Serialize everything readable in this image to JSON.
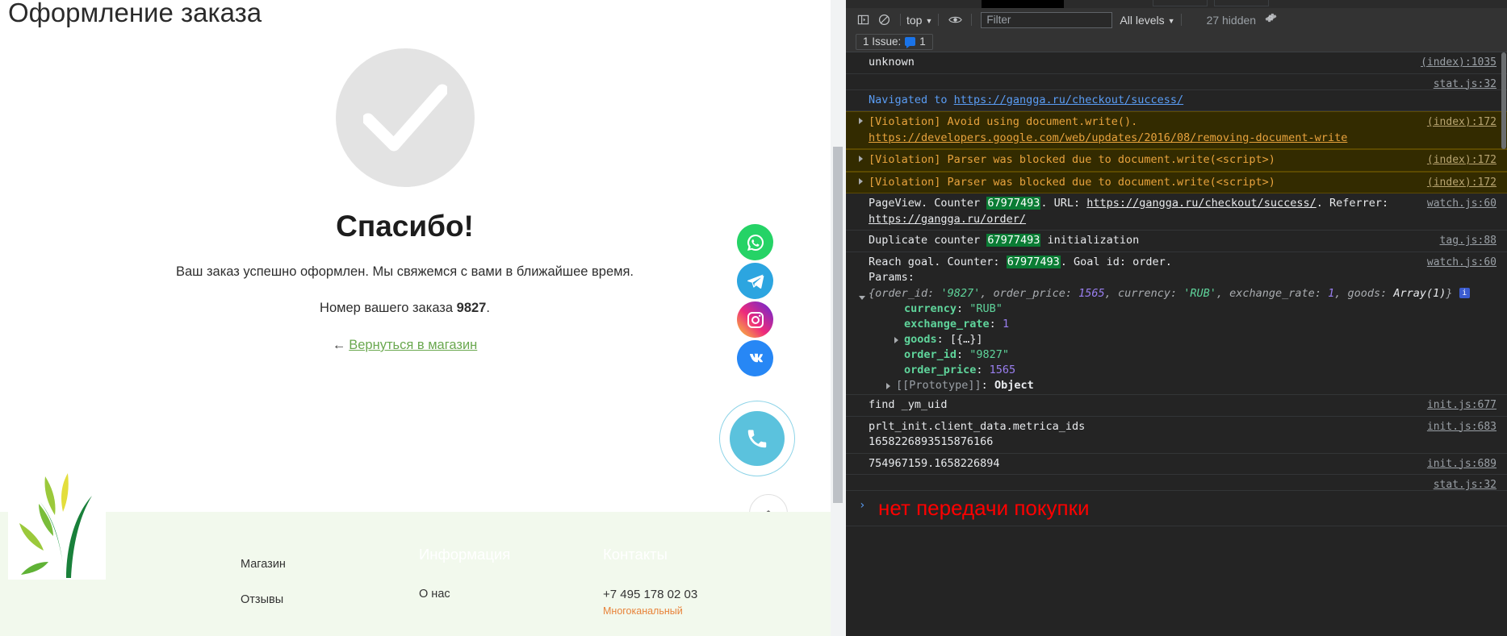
{
  "page": {
    "title": "Оформление заказа",
    "success": {
      "check_icon": "check-mark-icon",
      "heading": "Спасибо!",
      "subtext": "Ваш заказ успешно оформлен. Мы свяжемся с вами в ближайшее время.",
      "order_prefix": "Номер вашего заказа ",
      "order_number": "9827",
      "order_suffix": ".",
      "back_arrow": "←",
      "back_link": "Вернуться в магазин"
    },
    "social": [
      {
        "name": "whatsapp",
        "glyph": "whatsapp-icon"
      },
      {
        "name": "telegram",
        "glyph": "telegram-icon"
      },
      {
        "name": "instagram",
        "glyph": "instagram-icon"
      },
      {
        "name": "vk",
        "glyph": "vk-icon"
      }
    ],
    "call_button": "phone-icon",
    "scroll_top": "chevron-up-icon",
    "footer": {
      "columns": [
        {
          "head": "",
          "links": [
            "Магазин",
            "Отзывы"
          ]
        },
        {
          "head": "Информация",
          "links": [
            "О нас"
          ]
        },
        {
          "head": "Контакты",
          "phone": "+7 495 178 02 03",
          "phone_note": "Многоканальный"
        }
      ]
    }
  },
  "devtools": {
    "toolbar": {
      "sidebar_icon": "console-sidebar-icon",
      "clear_icon": "clear-console-icon",
      "context": "top",
      "eye_icon": "live-expression-icon",
      "filter_placeholder": "Filter",
      "levels": "All levels",
      "hidden": "27 hidden",
      "settings_icon": "gear-icon"
    },
    "issues": {
      "label_before": "1 Issue:",
      "badge_icon": "issue-badge-icon",
      "count": "1"
    },
    "messages": [
      {
        "id": "unknown",
        "type": "plain",
        "text": "unknown",
        "source": "(index):1035"
      },
      {
        "id": "stat-empty-1",
        "type": "plain",
        "text": "",
        "source": "stat.js:32"
      },
      {
        "id": "navigated",
        "type": "nav",
        "text_prefix": "Navigated to ",
        "link": "https://gangga.ru/checkout/success/",
        "source": ""
      },
      {
        "id": "violation-docwrite",
        "type": "warn",
        "text": "[Violation] Avoid using document.write(). ",
        "link": "https://developers.google.com/web/updates/2016/08/removing-document-write",
        "source": "(index):172"
      },
      {
        "id": "violation-parser-1",
        "type": "warn",
        "text": "[Violation] Parser was blocked due to document.write(<script>)",
        "source": "(index):172"
      },
      {
        "id": "violation-parser-2",
        "type": "warn",
        "text": "[Violation] Parser was blocked due to document.write(<script>)",
        "source": "(index):172"
      },
      {
        "id": "pageview",
        "type": "pageview",
        "prefix": "PageView. Counter ",
        "counter": "67977493",
        "mid": ". URL: ",
        "url": "https://gangga.ru/checkout/success/",
        "mid2": ". Referrer: ",
        "referrer": "https://gangga.ru/order/",
        "source": "watch.js:60"
      },
      {
        "id": "duplicate-counter",
        "type": "duplicate",
        "prefix": "Duplicate counter ",
        "counter": "67977493",
        "suffix": " initialization",
        "source": "tag.js:88"
      },
      {
        "id": "reach-goal",
        "type": "goal",
        "prefix": "Reach goal. Counter: ",
        "counter": "67977493",
        "suffix": ". Goal id: order.",
        "params_label": "Params:",
        "source": "watch.js:60",
        "object_preview": {
          "order_id_key": "order_id",
          "order_id_val": "'9827'",
          "order_price_key": "order_price",
          "order_price_val": "1565",
          "currency_key": "currency",
          "currency_val": "'RUB'",
          "exchange_rate_key": "exchange_rate",
          "exchange_rate_val": "1",
          "goods_key": "goods",
          "goods_val": "Array(1)"
        },
        "properties": [
          {
            "name": "currency",
            "value": "\"RUB\"",
            "vtype": "str",
            "expandable": false
          },
          {
            "name": "exchange_rate",
            "value": "1",
            "vtype": "num",
            "expandable": false
          },
          {
            "name": "goods",
            "value": "[{…}]",
            "vtype": "obj",
            "expandable": true
          },
          {
            "name": "order_id",
            "value": "\"9827\"",
            "vtype": "str",
            "expandable": false
          },
          {
            "name": "order_price",
            "value": "1565",
            "vtype": "num",
            "expandable": false
          },
          {
            "name": "[[Prototype]]",
            "value": "Object",
            "vtype": "proto",
            "expandable": true
          }
        ]
      },
      {
        "id": "find-ym-uid",
        "type": "plain",
        "text": "find _ym_uid",
        "source": "init.js:677"
      },
      {
        "id": "metrica-ids",
        "type": "plain",
        "text": "prlt_init.client_data.metrica_ids\n1658226893515876166",
        "source": "init.js:683"
      },
      {
        "id": "uid-value",
        "type": "plain",
        "text": "754967159.1658226894",
        "source": "init.js:689"
      },
      {
        "id": "stat-empty-2",
        "type": "plain",
        "text": "",
        "source": "stat.js:32"
      }
    ],
    "prompt": {
      "chevron": "›",
      "text": "нет передачи покупки"
    }
  }
}
